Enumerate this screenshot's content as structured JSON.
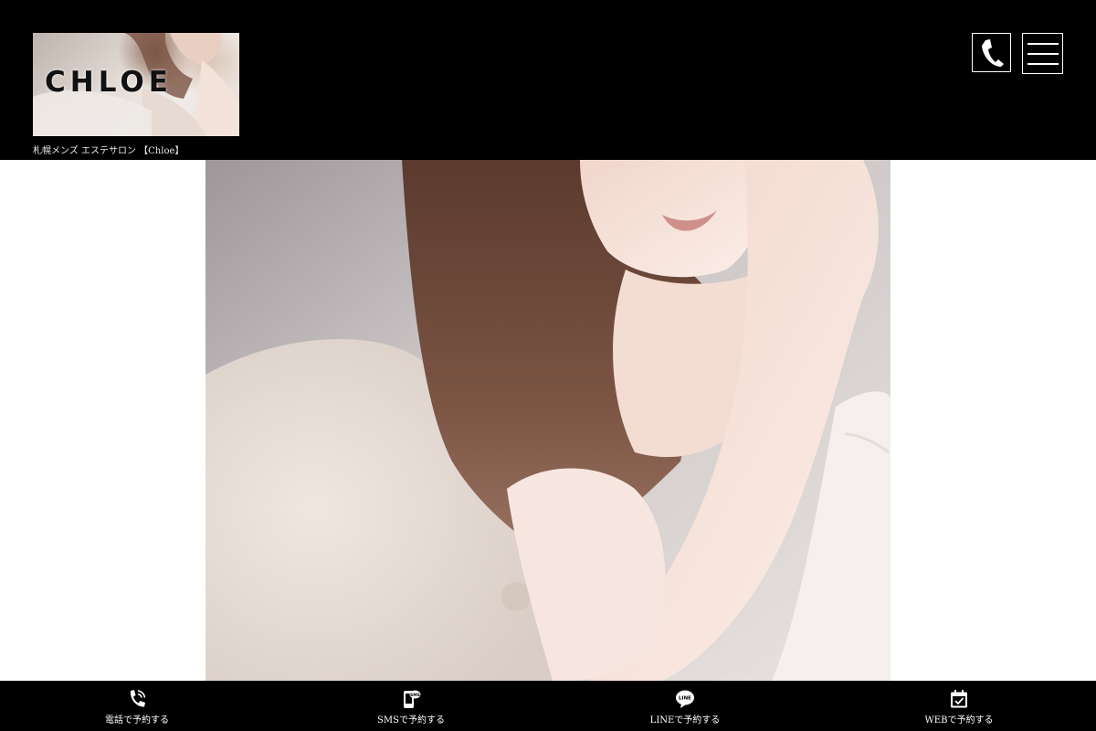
{
  "header": {
    "logo_text": "CHLOE",
    "tagline": "札幌メンズ エステサロン 【Chloe】",
    "phone_icon": "phone-icon",
    "menu_icon": "hamburger-menu-icon"
  },
  "hero": {
    "image": "woman-portrait-photo"
  },
  "bottom_nav": {
    "items": [
      {
        "label": "電話で予約する",
        "icon": "phone-ringing-icon"
      },
      {
        "label": "SMSで予約する",
        "icon": "sms-phone-icon"
      },
      {
        "label": "LINEで予約する",
        "icon": "line-chat-icon"
      },
      {
        "label": "WEBで予約する",
        "icon": "calendar-check-icon"
      }
    ]
  },
  "colors": {
    "header_bg": "#000000",
    "page_bg": "#ffffff",
    "nav_text": "#ffffff"
  }
}
